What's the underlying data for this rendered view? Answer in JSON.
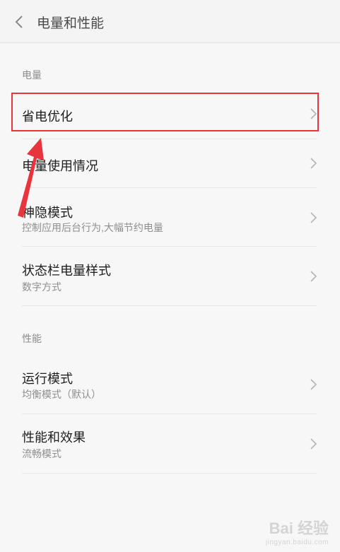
{
  "header": {
    "title": "电量和性能"
  },
  "sections": [
    {
      "header": "电量"
    },
    {
      "header": "性能"
    }
  ],
  "rows": [
    {
      "title": "省电优化",
      "subtitle": ""
    },
    {
      "title": "电量使用情况",
      "subtitle": ""
    },
    {
      "title": "神隐模式",
      "subtitle": "控制应用后台行为,大幅节约电量"
    },
    {
      "title": "状态栏电量样式",
      "subtitle": "数字方式"
    },
    {
      "title": "运行模式",
      "subtitle": "均衡模式（默认）"
    },
    {
      "title": "性能和效果",
      "subtitle": "流畅模式"
    }
  ],
  "annotation": {
    "color": "#e8343c"
  },
  "watermark": {
    "brand": "Bai 经验",
    "url": "jingyan.baidu.com"
  },
  "icons": {
    "back": "chevron-left-icon",
    "row": "chevron-right-icon"
  }
}
